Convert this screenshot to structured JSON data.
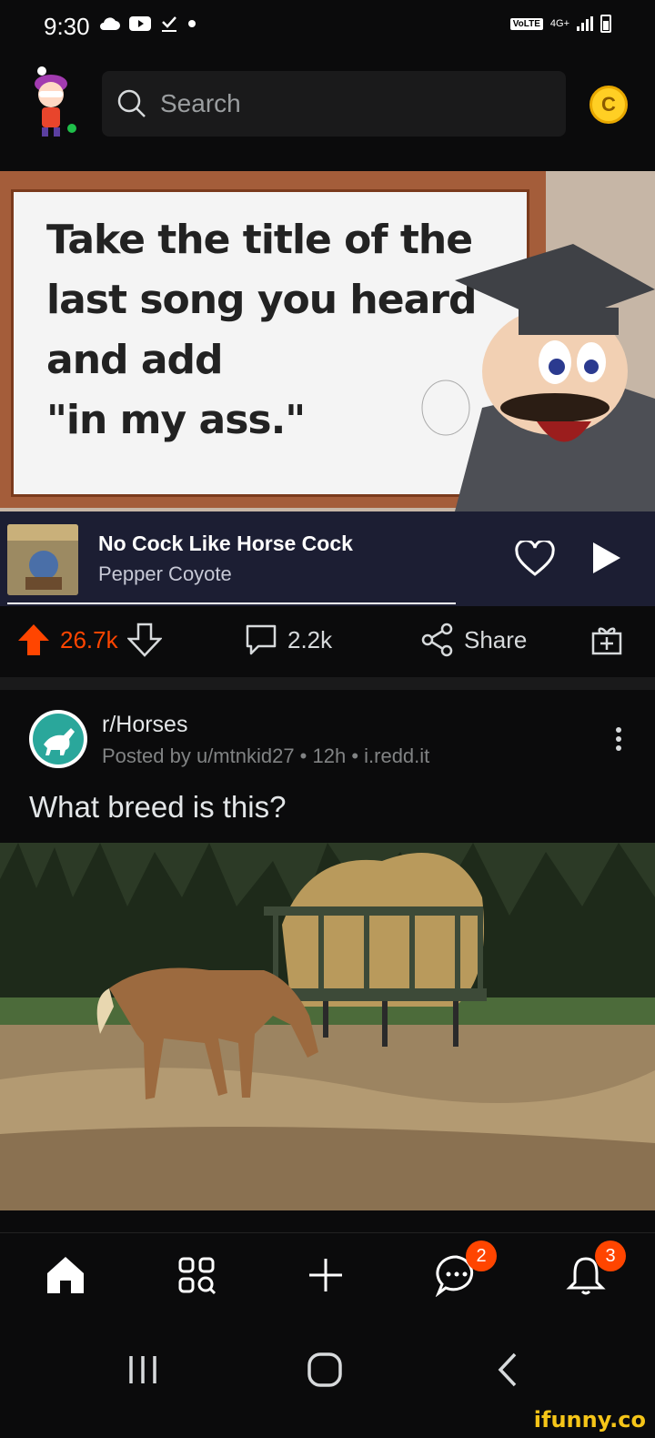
{
  "status_bar": {
    "time": "9:30",
    "network_label": "VoLTE",
    "network_type": "4G+"
  },
  "header": {
    "search_placeholder": "Search",
    "coin_label": "C"
  },
  "meme": {
    "sign_text": "Take the title of the\nlast song you heard\nand add\n\"in my ass.\""
  },
  "music": {
    "song_title": "No Cock Like Horse Cock",
    "artist": "Pepper Coyote",
    "progress": 0.7
  },
  "actions": {
    "upvotes": "26.7k",
    "comments": "2.2k",
    "share_label": "Share"
  },
  "post": {
    "subreddit": "r/Horses",
    "meta": "Posted by u/mtnkid27 • 12h • i.redd.it",
    "title": "What breed is this?"
  },
  "bottom_nav": {
    "items": [
      {
        "icon": "home-icon"
      },
      {
        "icon": "communities-icon"
      },
      {
        "icon": "create-post-icon"
      },
      {
        "icon": "chat-icon",
        "badge": "2"
      },
      {
        "icon": "bell-icon",
        "badge": "3"
      }
    ]
  },
  "watermark": "ifunny.co",
  "colors": {
    "accent": "#ff4500",
    "background": "#0b0b0c",
    "music_bar": "#1c1e33",
    "coin": "#ffcf24"
  }
}
